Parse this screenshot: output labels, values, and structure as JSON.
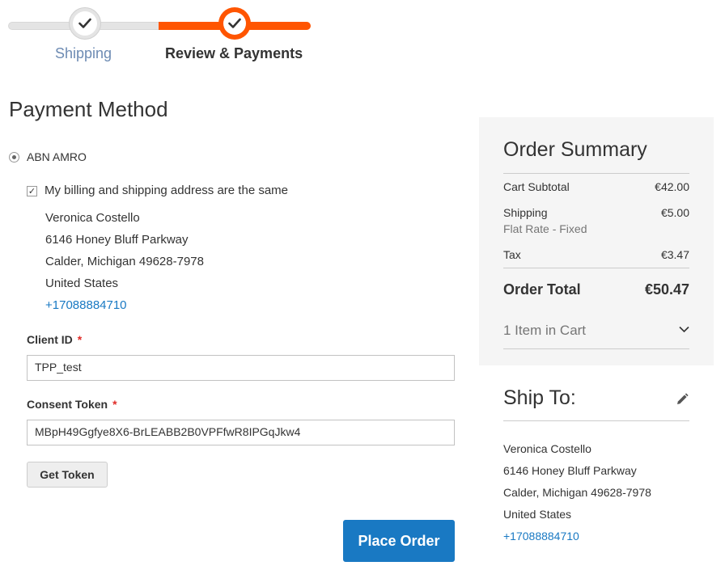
{
  "progress": {
    "steps": [
      {
        "label": "Shipping",
        "state": "completed"
      },
      {
        "label": "Review & Payments",
        "state": "active"
      }
    ],
    "colors": {
      "active": "#ff5501",
      "inactive": "#e4e4e4"
    }
  },
  "payment": {
    "title": "Payment Method",
    "method_label": "ABN AMRO",
    "same_address_label": "My billing and shipping address are the same",
    "same_address_checked": true,
    "billing_address": {
      "name": "Veronica Costello",
      "street": "6146 Honey Bluff Parkway",
      "city_line": "Calder, Michigan 49628-7978",
      "country": "United States",
      "phone": "+17088884710"
    },
    "client_id": {
      "label": "Client ID",
      "required_mark": "*",
      "value": "TPP_test"
    },
    "consent_token": {
      "label": "Consent Token",
      "required_mark": "*",
      "value": "MBpH49Ggfye8X6-BrLEABB2B0VPFfwR8IPGqJkw4"
    },
    "get_token_label": "Get Token",
    "place_order_label": "Place Order"
  },
  "summary": {
    "title": "Order Summary",
    "subtotal": {
      "label": "Cart Subtotal",
      "value": "€42.00"
    },
    "shipping": {
      "label": "Shipping",
      "value": "€5.00",
      "method": "Flat Rate - Fixed"
    },
    "tax": {
      "label": "Tax",
      "value": "€3.47"
    },
    "total": {
      "label": "Order Total",
      "value": "€50.47"
    },
    "items_in_cart": "1 Item in Cart"
  },
  "ship_to": {
    "title": "Ship To:",
    "name": "Veronica Costello",
    "street": "6146 Honey Bluff Parkway",
    "city_line": "Calder, Michigan 49628-7978",
    "country": "United States",
    "phone": "+17088884710"
  },
  "colors": {
    "link": "#1979c3",
    "primary_button": "#1979c3",
    "required": "#e02b27"
  }
}
